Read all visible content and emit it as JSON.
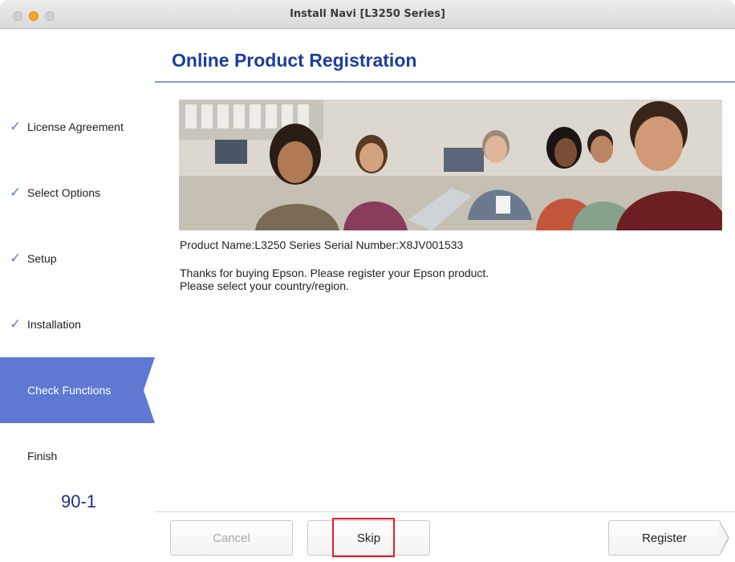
{
  "window": {
    "title": "Install Navi [L3250 Series]"
  },
  "sidebar": {
    "steps": [
      {
        "label": "License Agreement",
        "done": true,
        "check_icon": "checkmark-icon"
      },
      {
        "label": "Select Options",
        "done": true,
        "check_icon": "checkmark-icon"
      },
      {
        "label": "Setup",
        "done": true,
        "check_icon": "checkmark-icon"
      },
      {
        "label": "Installation",
        "done": true,
        "check_icon": "checkmark-icon"
      },
      {
        "label": "Check Functions",
        "active": true
      },
      {
        "label": "Finish"
      }
    ],
    "code": "90-1"
  },
  "main": {
    "title": "Online Product Registration",
    "product_info": "Product Name:L3250 Series  Serial Number:X8JV001533",
    "thanks": "Thanks for buying Epson. Please register your Epson product.",
    "select_prompt": "Please select your country/region."
  },
  "buttons": {
    "cancel": "Cancel",
    "skip": "Skip",
    "register": "Register"
  },
  "colors": {
    "accent": "#5f79d2",
    "title": "#1b3d9c",
    "highlight_box": "#e02020"
  }
}
